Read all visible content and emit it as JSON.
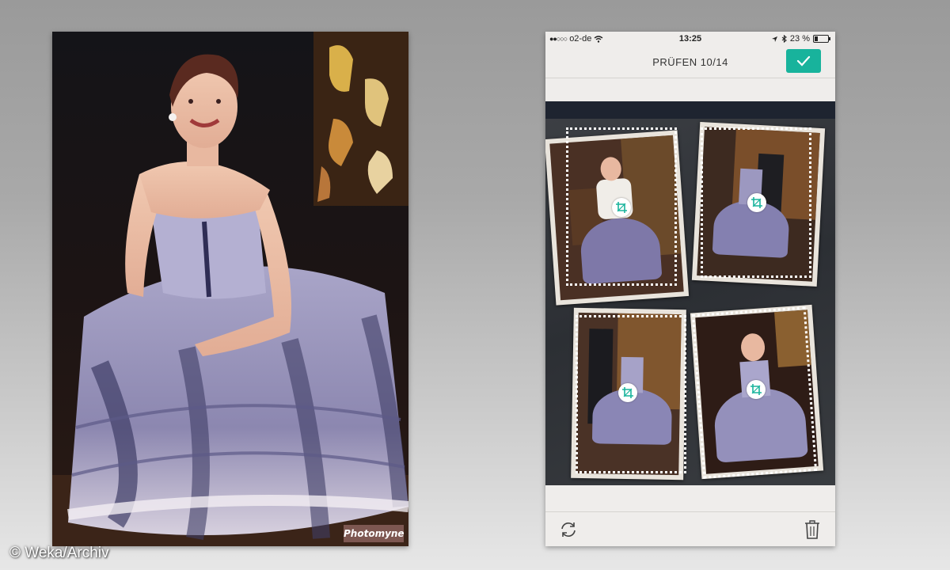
{
  "photo": {
    "watermark_text": "Photomyne"
  },
  "copyright": "© Weka/Archiv",
  "phone": {
    "status_bar": {
      "carrier": "o2-de",
      "time": "13:25",
      "battery": "23 %",
      "battery_level": 0.23
    },
    "nav": {
      "title": "PRÜFEN 10/14",
      "confirm_icon": "checkmark-icon",
      "accent_color": "#18b39c"
    },
    "scan": {
      "crop_icon": "crop-icon"
    },
    "toolbar": {
      "rotate_icon": "rotate-icon",
      "delete_icon": "trash-icon"
    }
  }
}
